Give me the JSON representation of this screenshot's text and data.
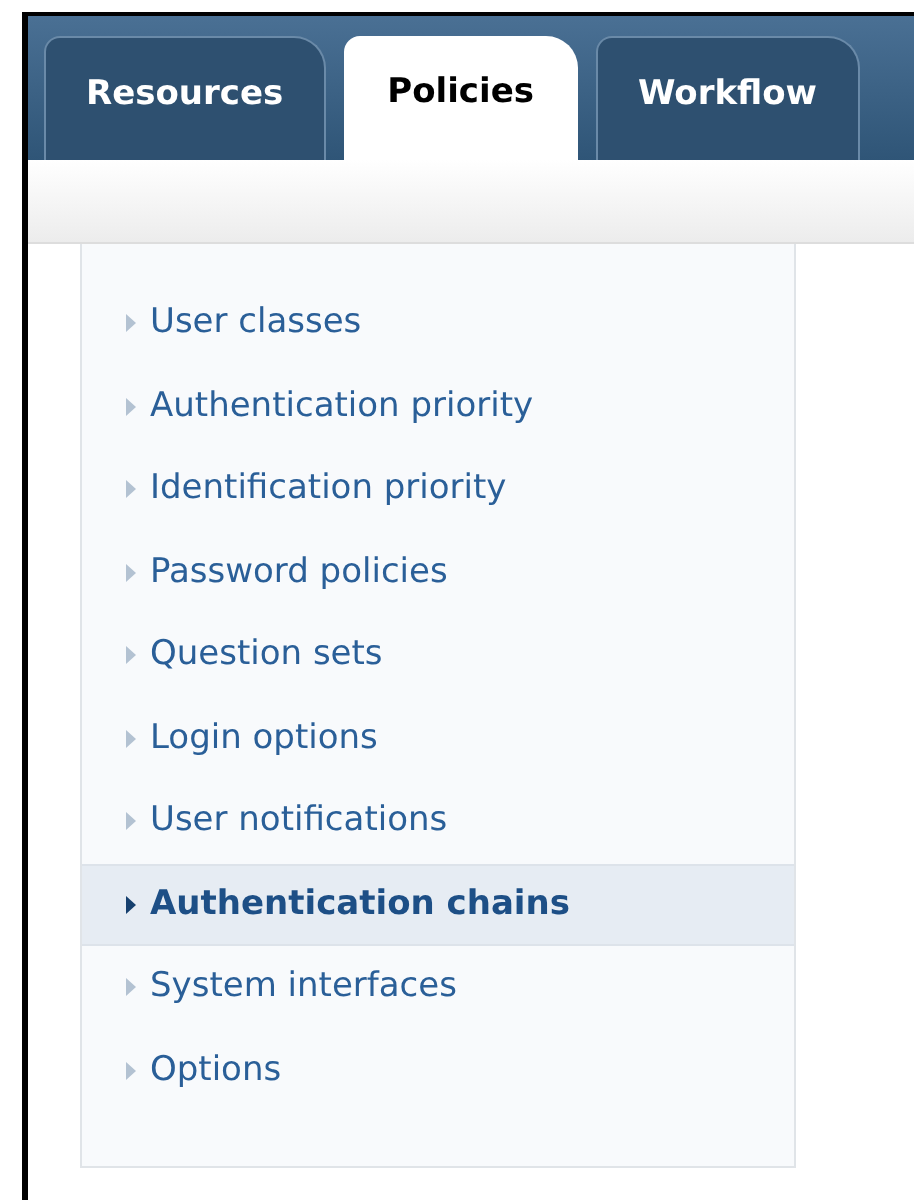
{
  "tabs": [
    {
      "label": "Resources",
      "selected": false
    },
    {
      "label": "Policies",
      "selected": true
    },
    {
      "label": "Workflow",
      "selected": false
    }
  ],
  "menu": {
    "items": [
      {
        "label": "User classes",
        "selected": false
      },
      {
        "label": "Authentication priority",
        "selected": false
      },
      {
        "label": "Identification priority",
        "selected": false
      },
      {
        "label": "Password policies",
        "selected": false
      },
      {
        "label": "Question sets",
        "selected": false
      },
      {
        "label": "Login options",
        "selected": false
      },
      {
        "label": "User notifications",
        "selected": false
      },
      {
        "label": "Authentication chains",
        "selected": true
      },
      {
        "label": "System interfaces",
        "selected": false
      },
      {
        "label": "Options",
        "selected": false
      }
    ]
  }
}
